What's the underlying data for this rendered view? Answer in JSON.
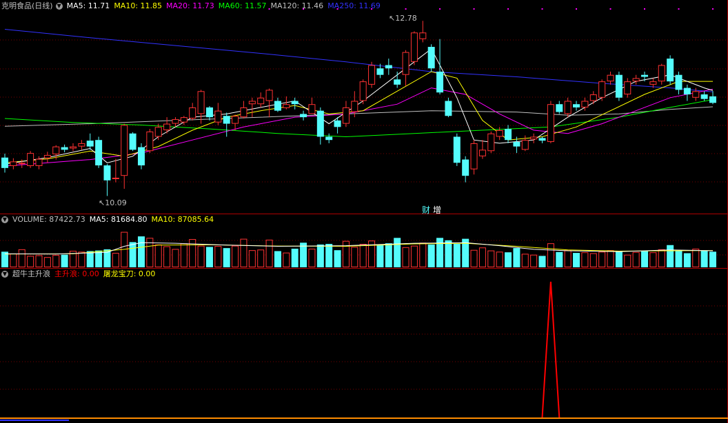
{
  "colors": {
    "up": "#ff3232",
    "down": "#54fcfc",
    "ma5": "#ffffff",
    "ma10": "#ffff00",
    "ma20": "#ff00ff",
    "ma60": "#00ff00",
    "ma120": "#c0c0c0",
    "ma250": "#3232ff",
    "grid": "#7a0000",
    "border": "#b00000",
    "signal_red": "#ff0000",
    "signal_yellow": "#ffff00"
  },
  "header": {
    "title": "克明食品(日线)",
    "ma5": "MA5: 11.71",
    "ma10": "MA10: 11.85",
    "ma20": "MA20: 11.73",
    "ma60": "MA60: 11.57",
    "ma120": "MA120: 11.46",
    "ma250": "MA250: 11.69"
  },
  "volume_header": {
    "title": "VOLUME: 87422.73",
    "ma5": "MA5: 81684.80",
    "ma10": "MA10: 87085.64"
  },
  "indicator_header": {
    "title": "超牛主升浪",
    "main": "主升浪: 0.00",
    "blade": "屠龙宝刀: 0.00"
  },
  "annotations": {
    "high_label": "12.78",
    "low_label": "10.09",
    "event_cai": "财",
    "event_zeng": "增"
  },
  "chart_data": [
    {
      "type": "candlestick",
      "title": "克明食品(日线)",
      "ylim": [
        9.82,
        12.92
      ],
      "high_value": 12.78,
      "low_value": 10.09,
      "candles": [
        [
          10.68,
          10.52,
          10.74,
          10.45
        ],
        [
          10.55,
          10.62,
          10.67,
          10.5
        ],
        [
          10.58,
          10.6,
          10.65,
          10.52
        ],
        [
          10.55,
          10.75,
          10.78,
          10.52
        ],
        [
          10.55,
          10.66,
          10.7,
          10.5
        ],
        [
          10.67,
          10.72,
          10.77,
          10.6
        ],
        [
          10.73,
          10.85,
          10.87,
          10.65
        ],
        [
          10.84,
          10.8,
          10.88,
          10.76
        ],
        [
          10.82,
          10.85,
          10.9,
          10.78
        ],
        [
          10.85,
          10.9,
          10.95,
          10.8
        ],
        [
          10.94,
          10.85,
          11.05,
          10.8
        ],
        [
          10.95,
          10.56,
          11.0,
          10.52
        ],
        [
          10.56,
          10.33,
          10.58,
          10.09
        ],
        [
          10.35,
          10.37,
          10.66,
          10.3
        ],
        [
          10.4,
          11.18,
          11.2,
          10.2
        ],
        [
          11.05,
          10.8,
          11.07,
          10.78
        ],
        [
          10.84,
          10.56,
          10.9,
          10.5
        ],
        [
          10.78,
          11.08,
          11.12,
          10.75
        ],
        [
          11.0,
          11.15,
          11.2,
          10.95
        ],
        [
          11.1,
          11.2,
          11.3,
          11.05
        ],
        [
          11.2,
          11.27,
          11.3,
          11.15
        ],
        [
          11.22,
          11.3,
          11.32,
          11.18
        ],
        [
          11.28,
          11.45,
          11.52,
          11.25
        ],
        [
          11.35,
          11.7,
          11.72,
          11.2
        ],
        [
          11.45,
          11.3,
          11.47,
          11.25
        ],
        [
          11.22,
          11.4,
          11.52,
          11.18
        ],
        [
          11.32,
          11.2,
          11.37,
          11.0
        ],
        [
          11.2,
          11.32,
          11.34,
          11.1
        ],
        [
          11.3,
          11.45,
          11.55,
          11.28
        ],
        [
          11.5,
          11.55,
          11.6,
          11.3
        ],
        [
          11.5,
          11.6,
          11.68,
          11.45
        ],
        [
          11.55,
          11.72,
          11.74,
          11.3
        ],
        [
          11.55,
          11.4,
          11.6,
          11.38
        ],
        [
          11.44,
          11.5,
          11.62,
          11.42
        ],
        [
          11.55,
          11.5,
          11.6,
          11.42
        ],
        [
          11.35,
          11.3,
          11.4,
          11.25
        ],
        [
          11.35,
          11.5,
          11.6,
          11.35
        ],
        [
          11.4,
          11.0,
          11.45,
          10.88
        ],
        [
          11.0,
          10.95,
          11.05,
          10.9
        ],
        [
          11.25,
          11.15,
          11.3,
          11.05
        ],
        [
          11.2,
          11.45,
          11.55,
          11.15
        ],
        [
          11.38,
          11.55,
          11.7,
          11.3
        ],
        [
          11.55,
          11.85,
          11.88,
          11.5
        ],
        [
          11.8,
          12.1,
          12.15,
          11.75
        ],
        [
          12.05,
          11.95,
          12.12,
          11.9
        ],
        [
          12.1,
          12.05,
          12.2,
          11.95
        ],
        [
          11.88,
          11.8,
          12.0,
          11.75
        ],
        [
          11.95,
          12.3,
          12.33,
          11.78
        ],
        [
          12.15,
          12.6,
          12.62,
          12.1
        ],
        [
          12.5,
          12.6,
          12.78,
          12.45
        ],
        [
          12.38,
          12.05,
          12.42,
          12.0
        ],
        [
          12.0,
          11.68,
          12.5,
          11.65
        ],
        [
          11.55,
          11.32,
          11.6,
          11.3
        ],
        [
          11.0,
          10.6,
          11.05,
          10.55
        ],
        [
          10.65,
          10.4,
          10.7,
          10.3
        ],
        [
          10.5,
          10.9,
          10.95,
          10.42
        ],
        [
          10.7,
          10.8,
          10.95,
          10.66
        ],
        [
          10.78,
          11.05,
          11.08,
          10.75
        ],
        [
          11.0,
          11.1,
          11.15,
          10.95
        ],
        [
          11.12,
          10.95,
          11.18,
          10.9
        ],
        [
          10.92,
          10.85,
          11.0,
          10.75
        ],
        [
          10.8,
          10.95,
          11.02,
          10.78
        ],
        [
          10.96,
          11.0,
          11.05,
          10.9
        ],
        [
          10.98,
          10.94,
          11.0,
          10.9
        ],
        [
          10.92,
          11.5,
          11.55,
          10.9
        ],
        [
          11.5,
          11.38,
          11.55,
          11.35
        ],
        [
          11.35,
          11.55,
          11.6,
          11.3
        ],
        [
          11.5,
          11.45,
          11.55,
          11.4
        ],
        [
          11.45,
          11.55,
          11.6,
          11.4
        ],
        [
          11.55,
          11.65,
          11.7,
          11.5
        ],
        [
          11.6,
          11.85,
          11.88,
          11.55
        ],
        [
          11.85,
          11.95,
          12.0,
          11.8
        ],
        [
          11.95,
          11.6,
          12.0,
          11.55
        ],
        [
          11.65,
          11.85,
          11.9,
          11.6
        ],
        [
          11.85,
          11.9,
          11.95,
          11.8
        ],
        [
          11.95,
          11.92,
          12.0,
          11.85
        ],
        [
          11.8,
          11.85,
          11.9,
          11.75
        ],
        [
          11.85,
          12.1,
          12.12,
          11.8
        ],
        [
          12.2,
          11.85,
          12.25,
          11.8
        ],
        [
          11.95,
          11.72,
          12.0,
          11.65
        ],
        [
          11.75,
          11.65,
          11.8,
          11.55
        ],
        [
          11.6,
          11.7,
          11.75,
          11.55
        ],
        [
          11.65,
          11.58,
          11.7,
          11.55
        ],
        [
          11.62,
          11.52,
          11.7,
          11.5
        ]
      ],
      "ma": [
        {
          "name": "MA5",
          "color": "#ffffff",
          "points": [
            [
              0,
              10.58
            ],
            [
              5,
              10.68
            ],
            [
              10,
              10.82
            ],
            [
              12,
              10.6
            ],
            [
              15,
              10.7
            ],
            [
              18,
              11.0
            ],
            [
              22,
              11.3
            ],
            [
              26,
              11.35
            ],
            [
              30,
              11.45
            ],
            [
              34,
              11.55
            ],
            [
              38,
              11.2
            ],
            [
              42,
              11.55
            ],
            [
              46,
              11.95
            ],
            [
              50,
              12.35
            ],
            [
              53,
              11.6
            ],
            [
              55,
              10.95
            ],
            [
              58,
              10.9
            ],
            [
              62,
              10.95
            ],
            [
              66,
              11.3
            ],
            [
              70,
              11.6
            ],
            [
              74,
              11.85
            ],
            [
              78,
              11.95
            ],
            [
              82,
              11.75
            ],
            [
              83,
              11.71
            ]
          ]
        },
        {
          "name": "MA10",
          "color": "#ffff00",
          "points": [
            [
              0,
              10.6
            ],
            [
              5,
              10.66
            ],
            [
              10,
              10.78
            ],
            [
              14,
              10.7
            ],
            [
              18,
              10.85
            ],
            [
              22,
              11.1
            ],
            [
              26,
              11.3
            ],
            [
              30,
              11.4
            ],
            [
              34,
              11.48
            ],
            [
              38,
              11.35
            ],
            [
              42,
              11.4
            ],
            [
              46,
              11.7
            ],
            [
              50,
              12.0
            ],
            [
              53,
              11.9
            ],
            [
              56,
              11.25
            ],
            [
              59,
              10.95
            ],
            [
              63,
              11.0
            ],
            [
              67,
              11.15
            ],
            [
              71,
              11.4
            ],
            [
              75,
              11.65
            ],
            [
              79,
              11.85
            ],
            [
              83,
              11.85
            ]
          ]
        },
        {
          "name": "MA20",
          "color": "#ff00ff",
          "points": [
            [
              0,
              10.55
            ],
            [
              10,
              10.65
            ],
            [
              16,
              10.75
            ],
            [
              22,
              10.95
            ],
            [
              28,
              11.15
            ],
            [
              34,
              11.3
            ],
            [
              40,
              11.35
            ],
            [
              46,
              11.5
            ],
            [
              50,
              11.75
            ],
            [
              54,
              11.65
            ],
            [
              58,
              11.35
            ],
            [
              62,
              11.1
            ],
            [
              66,
              11.05
            ],
            [
              70,
              11.2
            ],
            [
              74,
              11.4
            ],
            [
              78,
              11.6
            ],
            [
              83,
              11.73
            ]
          ]
        },
        {
          "name": "MA60",
          "color": "#00ff00",
          "points": [
            [
              0,
              11.28
            ],
            [
              8,
              11.22
            ],
            [
              16,
              11.18
            ],
            [
              24,
              11.12
            ],
            [
              32,
              11.05
            ],
            [
              40,
              11.0
            ],
            [
              48,
              11.05
            ],
            [
              56,
              11.1
            ],
            [
              64,
              11.15
            ],
            [
              72,
              11.3
            ],
            [
              78,
              11.45
            ],
            [
              83,
              11.57
            ]
          ]
        },
        {
          "name": "MA120",
          "color": "#c0c0c0",
          "points": [
            [
              0,
              11.16
            ],
            [
              10,
              11.2
            ],
            [
              20,
              11.25
            ],
            [
              30,
              11.3
            ],
            [
              40,
              11.35
            ],
            [
              50,
              11.4
            ],
            [
              60,
              11.38
            ],
            [
              66,
              11.33
            ],
            [
              72,
              11.35
            ],
            [
              78,
              11.42
            ],
            [
              83,
              11.46
            ]
          ]
        },
        {
          "name": "MA250",
          "color": "#3232ff",
          "points": [
            [
              0,
              12.65
            ],
            [
              10,
              12.52
            ],
            [
              20,
              12.4
            ],
            [
              30,
              12.28
            ],
            [
              40,
              12.15
            ],
            [
              50,
              12.0
            ],
            [
              60,
              11.92
            ],
            [
              70,
              11.82
            ],
            [
              78,
              11.75
            ],
            [
              83,
              11.69
            ]
          ]
        }
      ]
    },
    {
      "type": "bar",
      "title": "VOLUME",
      "ylim": [
        0,
        140000
      ],
      "values": [
        52000,
        46000,
        60000,
        38000,
        40000,
        34000,
        41000,
        42000,
        55000,
        52000,
        54000,
        56000,
        60000,
        48000,
        118000,
        84000,
        103000,
        98000,
        76000,
        70000,
        61000,
        80000,
        94000,
        72000,
        68000,
        71000,
        64000,
        72000,
        95000,
        57000,
        59000,
        92000,
        54000,
        49000,
        62000,
        82000,
        62000,
        76000,
        78000,
        57000,
        88000,
        68000,
        78000,
        89000,
        76000,
        80000,
        98000,
        67000,
        72000,
        82000,
        76000,
        98000,
        90000,
        78000,
        95000,
        58000,
        66000,
        56000,
        52000,
        50000,
        64000,
        45000,
        42000,
        38000,
        80000,
        51000,
        57000,
        48000,
        50000,
        47000,
        52000,
        57000,
        54000,
        42000,
        51000,
        54000,
        50000,
        60000,
        74000,
        56000,
        47000,
        62000,
        55000,
        52000
      ],
      "ma5_series": [
        [
          0,
          45000
        ],
        [
          6,
          44000
        ],
        [
          12,
          50000
        ],
        [
          14,
          70000
        ],
        [
          16,
          82000
        ],
        [
          20,
          80000
        ],
        [
          26,
          74000
        ],
        [
          32,
          70000
        ],
        [
          40,
          72000
        ],
        [
          48,
          80000
        ],
        [
          54,
          82000
        ],
        [
          58,
          72000
        ],
        [
          62,
          60000
        ],
        [
          66,
          55000
        ],
        [
          72,
          52000
        ],
        [
          78,
          58000
        ],
        [
          83,
          55000
        ]
      ],
      "ma10_series": [
        [
          0,
          44000
        ],
        [
          8,
          45000
        ],
        [
          14,
          60000
        ],
        [
          18,
          74000
        ],
        [
          24,
          75000
        ],
        [
          32,
          71000
        ],
        [
          40,
          70000
        ],
        [
          48,
          78000
        ],
        [
          54,
          80000
        ],
        [
          60,
          70000
        ],
        [
          66,
          58000
        ],
        [
          72,
          54000
        ],
        [
          78,
          55000
        ],
        [
          83,
          56000
        ]
      ]
    },
    {
      "type": "line",
      "title": "超牛主升浪",
      "ylim": [
        0,
        1
      ],
      "signal_index": 64,
      "signal_value": 1
    }
  ]
}
